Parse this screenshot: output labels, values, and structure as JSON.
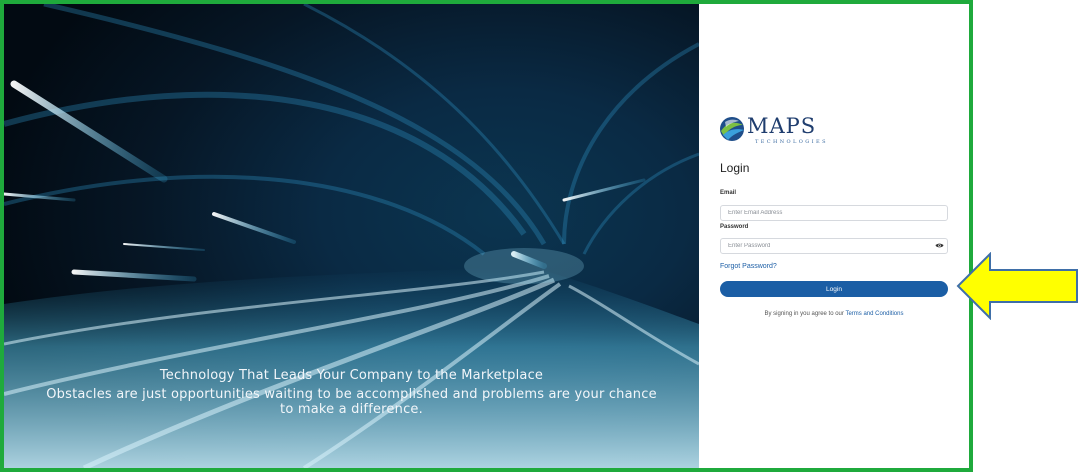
{
  "hero": {
    "title": "Technology That Leads Your Company to the Marketplace",
    "subtitle": "Obstacles are just opportunities waiting to be accomplished and problems are your chance to make a difference."
  },
  "logo": {
    "wordmark": "MAPS",
    "tagline": "TECHNOLOGIES",
    "icon": "globe-logo-icon"
  },
  "login": {
    "heading": "Login",
    "email_label": "Email",
    "email_placeholder": "Enter Email Address",
    "email_value": "",
    "password_label": "Password",
    "password_placeholder": "Enter Password",
    "password_value": "",
    "password_toggle_icon": "eye-icon",
    "forgot_label": "Forgot Password?",
    "button_label": "Login",
    "terms_prefix": "By signing in you agree to our ",
    "terms_link": "Terms and Conditions"
  },
  "annotation": {
    "arrow_icon": "yellow-arrow-icon"
  },
  "colors": {
    "frame_border": "#1faa3c",
    "primary": "#1b5ea5",
    "link": "#1d5fa6",
    "arrow_fill": "#ffff00",
    "arrow_stroke": "#3f6fa8"
  }
}
